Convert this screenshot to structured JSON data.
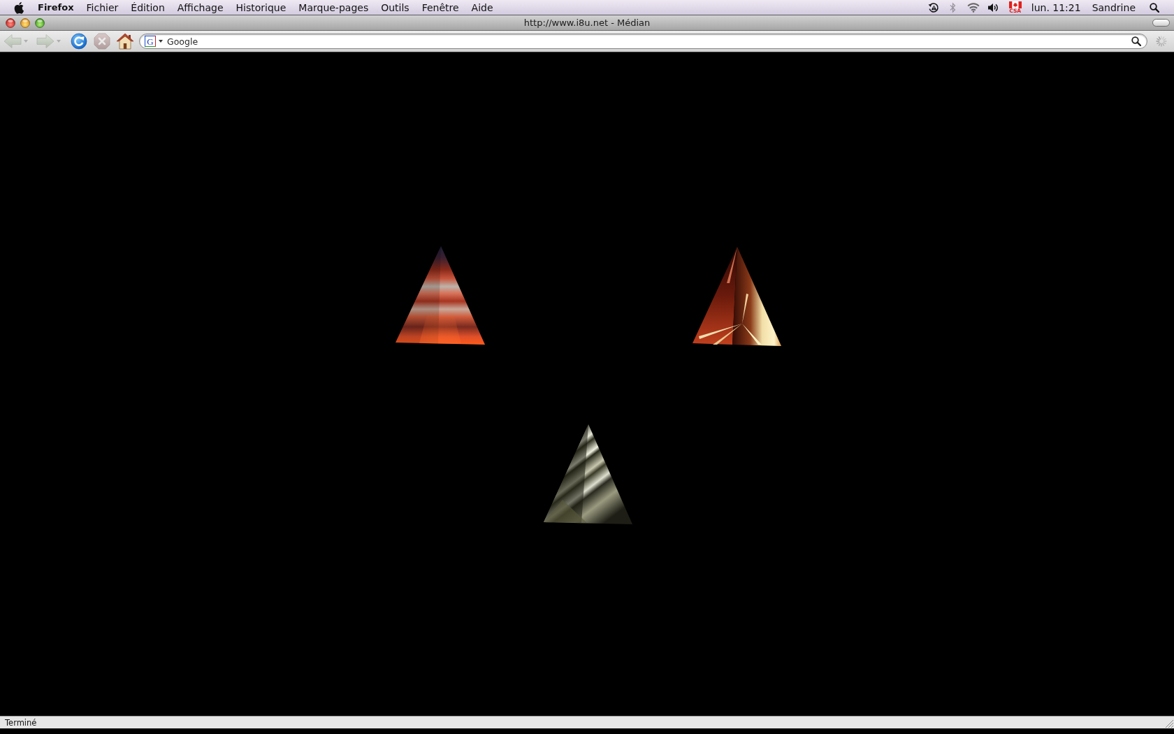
{
  "menu_bar": {
    "app_name": "Firefox",
    "menus": [
      "Fichier",
      "Édition",
      "Affichage",
      "Historique",
      "Marque-pages",
      "Outils",
      "Fenêtre",
      "Aide"
    ],
    "status_items": [
      {
        "kind": "time-machine",
        "disabled": false
      },
      {
        "kind": "bluetooth",
        "disabled": true
      },
      {
        "kind": "wifi",
        "disabled": false
      },
      {
        "kind": "volume",
        "disabled": false
      },
      {
        "kind": "input-source",
        "label": "CSA",
        "disabled": false
      }
    ],
    "clock": "lun. 11:21",
    "user": "Sandrine"
  },
  "window": {
    "title": "http://www.i8u.net - Médian"
  },
  "toolbar": {
    "buttons": [
      {
        "kind": "back",
        "disabled": true
      },
      {
        "kind": "forward",
        "disabled": true
      },
      {
        "kind": "reload",
        "disabled": false
      },
      {
        "kind": "stop",
        "disabled": true
      },
      {
        "kind": "home",
        "disabled": false
      }
    ],
    "search": {
      "engine_logo": "G",
      "placeholder": "Google"
    }
  },
  "status_bar": {
    "text": "Terminé"
  }
}
